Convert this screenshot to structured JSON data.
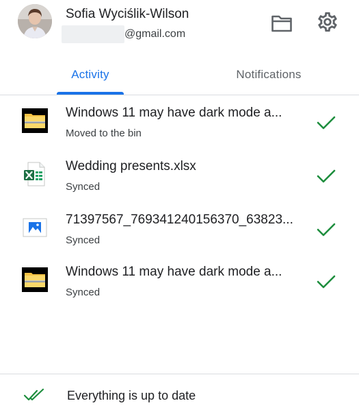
{
  "account": {
    "name": "Sofia Wyciślik-Wilson",
    "email_visible": "@gmail.com"
  },
  "toolbar": {
    "folder_icon": "folder-icon",
    "settings_icon": "gear-icon"
  },
  "tabs": [
    {
      "label": "Activity",
      "selected": true
    },
    {
      "label": "Notifications",
      "selected": false
    }
  ],
  "activity": [
    {
      "title": "Windows 11 may have dark mode a...",
      "status": "Moved to the bin",
      "icon": "zip-folder-icon",
      "synced": true
    },
    {
      "title": "Wedding presents.xlsx",
      "status": "Synced",
      "icon": "excel-file-icon",
      "synced": true
    },
    {
      "title": "71397567_769341240156370_63823...",
      "status": "Synced",
      "icon": "image-file-icon",
      "synced": true
    },
    {
      "title": "Windows 11 may have dark mode a...",
      "status": "Synced",
      "icon": "zip-folder-icon",
      "synced": true
    }
  ],
  "footer": {
    "status": "Everything is up to date"
  },
  "colors": {
    "accent": "#1a73e8",
    "check_green": "#1e8e3e",
    "divider": "#dadce0"
  }
}
